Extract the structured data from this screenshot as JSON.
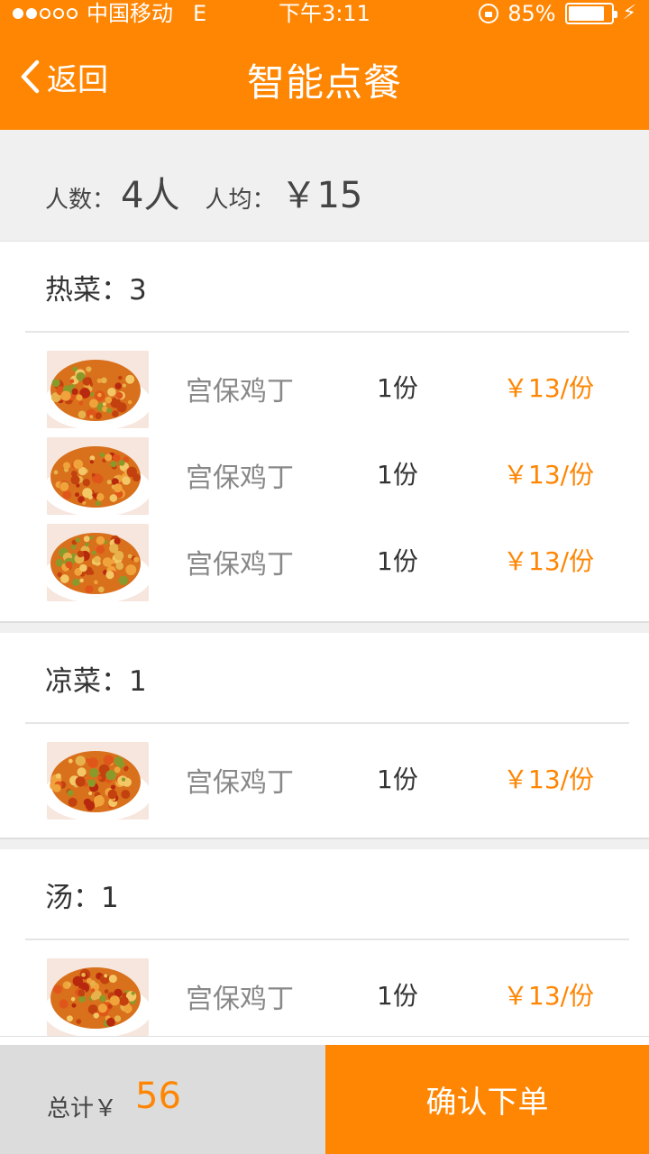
{
  "status_bar": {
    "carrier": "中国移动",
    "network": "E",
    "time": "下午3:11",
    "battery_percent": "85%",
    "battery_level": 0.85
  },
  "nav": {
    "back_label": "返回",
    "title": "智能点餐"
  },
  "summary": {
    "people_label": "人数：",
    "people_value": "4人",
    "avg_label": "人均：",
    "avg_value": "￥15"
  },
  "sections": [
    {
      "header": "热菜：3",
      "dishes": [
        {
          "name": "宫保鸡丁",
          "qty": "1份",
          "price": "￥13/份"
        },
        {
          "name": "宫保鸡丁",
          "qty": "1份",
          "price": "￥13/份"
        },
        {
          "name": "宫保鸡丁",
          "qty": "1份",
          "price": "￥13/份"
        }
      ]
    },
    {
      "header": "凉菜：1",
      "dishes": [
        {
          "name": "宫保鸡丁",
          "qty": "1份",
          "price": "￥13/份"
        }
      ]
    },
    {
      "header": "汤：1",
      "dishes": [
        {
          "name": "宫保鸡丁",
          "qty": "1份",
          "price": "￥13/份"
        }
      ]
    }
  ],
  "footer": {
    "total_label": "总计￥",
    "total_value": "56",
    "confirm_label": "确认下单"
  },
  "colors": {
    "accent": "#ff8603",
    "background": "#f0f0f0"
  }
}
